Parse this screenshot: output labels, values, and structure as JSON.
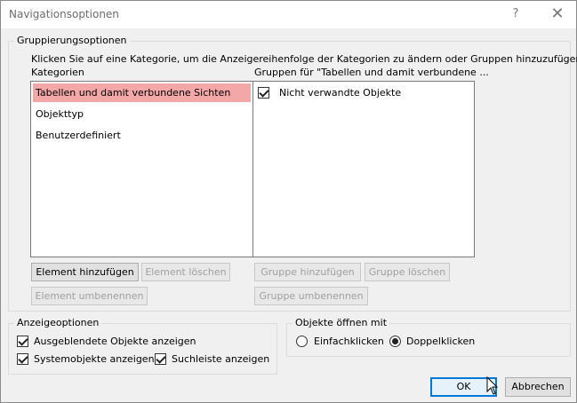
{
  "window": {
    "title": "Navigationsoptionen",
    "help_glyph": "?",
    "close_glyph": "✕"
  },
  "grouping": {
    "legend": "Gruppierungsoptionen",
    "instruction": "Klicken Sie auf eine Kategorie, um die Anzeigereihenfolge der Kategorien zu ändern oder Gruppen hinzuzufügen",
    "categories_header": "Kategorien",
    "groups_header": "Gruppen für \"Tabellen und damit verbundene ...",
    "categories": [
      "Tabellen und damit verbundene Sichten",
      "Objekttyp",
      "Benutzerdefiniert"
    ],
    "groups": [
      {
        "label": "Nicht verwandte Objekte",
        "checked": true
      }
    ],
    "buttons": {
      "add_element": "Element hinzufügen",
      "delete_element": "Element löschen",
      "rename_element": "Element umbenennen",
      "add_group": "Gruppe hinzufügen",
      "delete_group": "Gruppe löschen",
      "rename_group": "Gruppe umbenennen"
    }
  },
  "display": {
    "legend": "Anzeigeoptionen",
    "show_hidden": "Ausgeblendete Objekte anzeigen",
    "show_system": "Systemobjekte anzeigen",
    "show_search": "Suchleiste anzeigen"
  },
  "open": {
    "legend": "Objekte öffnen mit",
    "single_click": "Einfachklicken",
    "double_click": "Doppelklicken"
  },
  "footer": {
    "ok": "OK",
    "cancel": "Abbrechen"
  },
  "colors": {
    "selection": "#f4a7a7",
    "default_button_border": "#0078d7"
  }
}
